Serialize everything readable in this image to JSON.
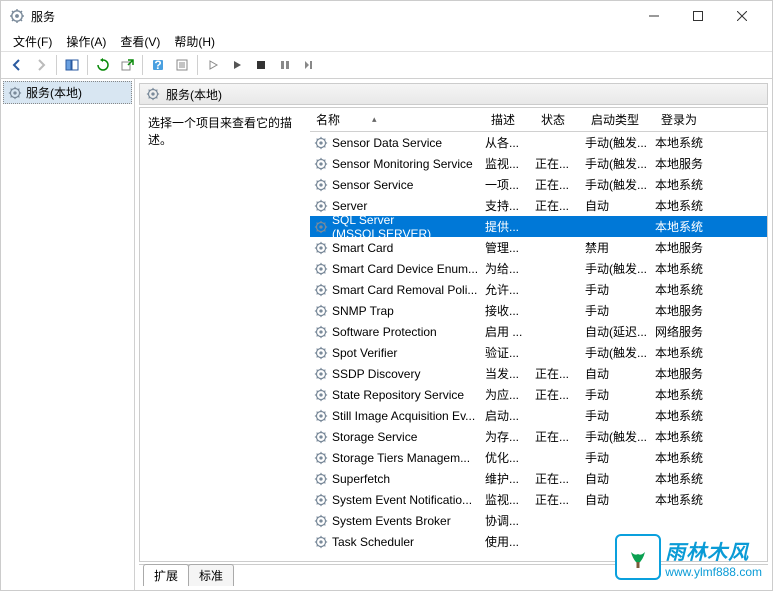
{
  "window": {
    "title": "服务"
  },
  "menus": {
    "file": "文件(F)",
    "action": "操作(A)",
    "view": "查看(V)",
    "help": "帮助(H)"
  },
  "tree": {
    "root": "服务(本地)"
  },
  "header": {
    "label": "服务(本地)"
  },
  "desc": {
    "hint": "选择一个项目来查看它的描述。"
  },
  "columns": {
    "name": "名称",
    "desc": "描述",
    "status": "状态",
    "startup": "启动类型",
    "logon": "登录为"
  },
  "tabs": {
    "extended": "扩展",
    "standard": "标准"
  },
  "watermark": {
    "title": "雨林木风",
    "url": "www.ylmf888.com"
  },
  "services": [
    {
      "name": "Sensor Data Service",
      "desc": "从各...",
      "status": "",
      "startup": "手动(触发...",
      "logon": "本地系统"
    },
    {
      "name": "Sensor Monitoring Service",
      "desc": "监视...",
      "status": "正在...",
      "startup": "手动(触发...",
      "logon": "本地服务"
    },
    {
      "name": "Sensor Service",
      "desc": "一项...",
      "status": "正在...",
      "startup": "手动(触发...",
      "logon": "本地系统"
    },
    {
      "name": "Server",
      "desc": "支持...",
      "status": "正在...",
      "startup": "自动",
      "logon": "本地系统"
    },
    {
      "name": "SQL Server (MSSQLSERVER)",
      "desc": "提供...",
      "status": "",
      "startup": "",
      "logon": "本地系统"
    },
    {
      "name": "Smart Card",
      "desc": "管理...",
      "status": "",
      "startup": "禁用",
      "logon": "本地服务"
    },
    {
      "name": "Smart Card Device Enum...",
      "desc": "为给...",
      "status": "",
      "startup": "手动(触发...",
      "logon": "本地系统"
    },
    {
      "name": "Smart Card Removal Poli...",
      "desc": "允许...",
      "status": "",
      "startup": "手动",
      "logon": "本地系统"
    },
    {
      "name": "SNMP Trap",
      "desc": "接收...",
      "status": "",
      "startup": "手动",
      "logon": "本地服务"
    },
    {
      "name": "Software Protection",
      "desc": "启用 ...",
      "status": "",
      "startup": "自动(延迟...",
      "logon": "网络服务"
    },
    {
      "name": "Spot Verifier",
      "desc": "验证...",
      "status": "",
      "startup": "手动(触发...",
      "logon": "本地系统"
    },
    {
      "name": "SSDP Discovery",
      "desc": "当发...",
      "status": "正在...",
      "startup": "自动",
      "logon": "本地服务"
    },
    {
      "name": "State Repository Service",
      "desc": "为应...",
      "status": "正在...",
      "startup": "手动",
      "logon": "本地系统"
    },
    {
      "name": "Still Image Acquisition Ev...",
      "desc": "启动...",
      "status": "",
      "startup": "手动",
      "logon": "本地系统"
    },
    {
      "name": "Storage Service",
      "desc": "为存...",
      "status": "正在...",
      "startup": "手动(触发...",
      "logon": "本地系统"
    },
    {
      "name": "Storage Tiers Managem...",
      "desc": "优化...",
      "status": "",
      "startup": "手动",
      "logon": "本地系统"
    },
    {
      "name": "Superfetch",
      "desc": "维护...",
      "status": "正在...",
      "startup": "自动",
      "logon": "本地系统"
    },
    {
      "name": "System Event Notificatio...",
      "desc": "监视...",
      "status": "正在...",
      "startup": "自动",
      "logon": "本地系统"
    },
    {
      "name": "System Events Broker",
      "desc": "协调...",
      "status": "",
      "startup": "",
      "logon": ""
    },
    {
      "name": "Task Scheduler",
      "desc": "使用...",
      "status": "",
      "startup": "",
      "logon": ""
    }
  ]
}
